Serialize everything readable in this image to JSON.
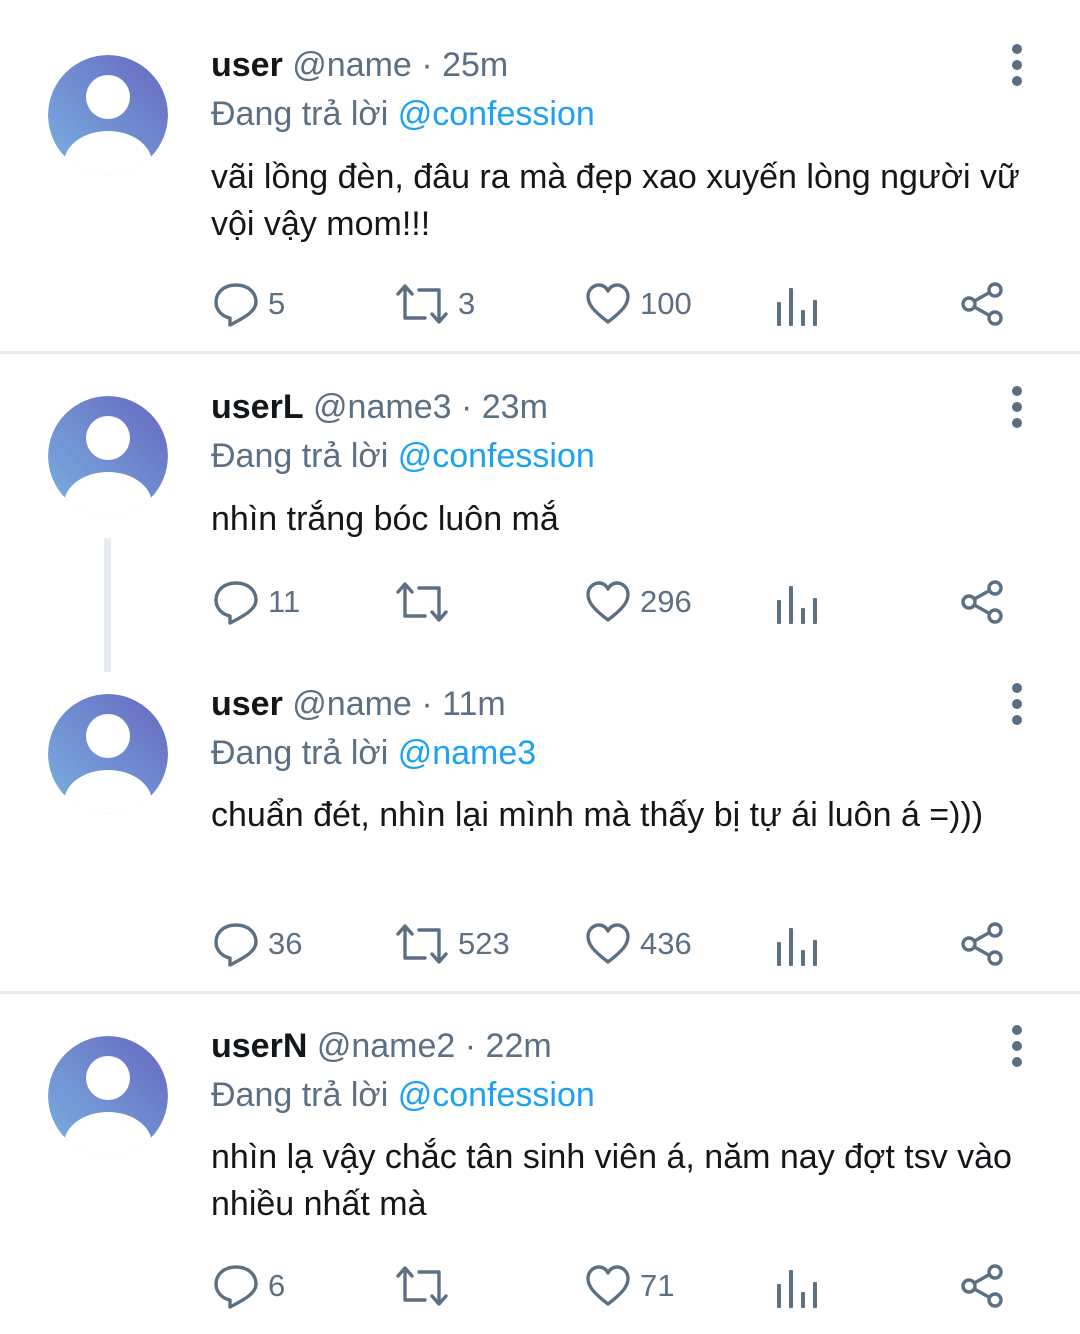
{
  "tweets": [
    {
      "user": "user",
      "handle": "@name",
      "time": "· 25m",
      "replying_prefix": "Đang trả lời",
      "replying_to": "@confession",
      "text": "vãi lồng đèn, đâu ra mà đẹp xao xuyến lòng người vữ vội vậy mom!!!",
      "replies": "5",
      "retweets": "3",
      "likes": "100"
    },
    {
      "user": "userL",
      "handle": "@name3",
      "time": "· 23m",
      "replying_prefix": "Đang trả lời",
      "replying_to": "@confession",
      "text": "nhìn trắng bóc luôn mắ",
      "replies": "11",
      "retweets": "",
      "likes": "296"
    },
    {
      "user": "user",
      "handle": "@name",
      "time": "· 11m",
      "replying_prefix": "Đang trả lời",
      "replying_to": "@name3",
      "text": "chuẩn đét, nhìn lại mình mà thấy bị tự ái luôn á =)))",
      "replies": "36",
      "retweets": "523",
      "likes": "436"
    },
    {
      "user": "userN",
      "handle": "@name2",
      "time": "· 22m",
      "replying_prefix": "Đang trả lời",
      "replying_to": "@confession",
      "text": "nhìn lạ vậy chắc tân sinh viên á, năm nay đợt tsv vào nhiều nhất mà",
      "replies": "6",
      "retweets": "",
      "likes": "71"
    }
  ],
  "icons": {
    "avatar": "default-avatar-icon",
    "more": "more-vertical-icon",
    "reply": "reply-icon",
    "retweet": "retweet-icon",
    "like": "heart-icon",
    "analytics": "analytics-icon",
    "share": "share-icon"
  },
  "colors": {
    "name": "#14171a",
    "secondary": "#5b7083",
    "mention": "#1da1f2",
    "avatar_start": "#7ab1e2",
    "avatar_end": "#6668bf",
    "divider": "#e8ecef"
  }
}
